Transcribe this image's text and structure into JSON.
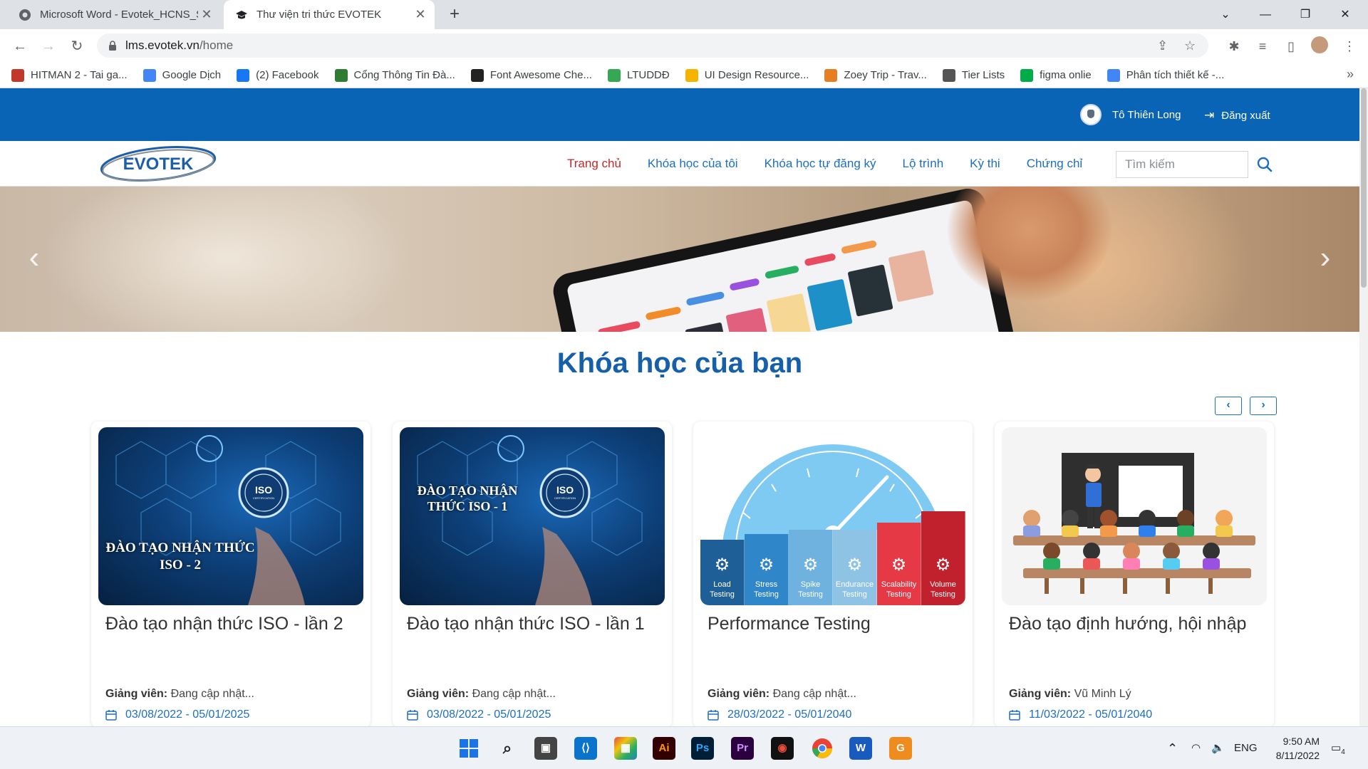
{
  "browser": {
    "tabs": [
      {
        "title": "Microsoft Word - Evotek_HCNS_S",
        "active": false
      },
      {
        "title": "Thư viện tri thức EVOTEK",
        "active": true
      }
    ],
    "url_host": "lms.evotek.vn",
    "url_path": "/home",
    "bookmarks": [
      {
        "label": "HITMAN 2 - Tai ga...",
        "color": "#c0392b"
      },
      {
        "label": "Google Dịch",
        "color": "#4285f4"
      },
      {
        "label": "(2) Facebook",
        "color": "#1877f2"
      },
      {
        "label": "Cổng Thông Tin Đà...",
        "color": "#2e7d32"
      },
      {
        "label": "Font Awesome Che...",
        "color": "#222222"
      },
      {
        "label": "LTUDDĐ",
        "color": "#34a853"
      },
      {
        "label": "UI Design Resource...",
        "color": "#f4b400"
      },
      {
        "label": "Zoey Trip - Trav...",
        "color": "#e67e22"
      },
      {
        "label": "Tier Lists",
        "color": "#555555"
      },
      {
        "label": "figma onlie",
        "color": "#00ac47"
      },
      {
        "label": "Phân tích thiết kế -...",
        "color": "#4285f4"
      }
    ]
  },
  "site": {
    "user_name": "Tô Thiên Long",
    "logout_label": "Đăng xuất",
    "logo_text": "EVOTEK",
    "nav": [
      {
        "label": "Trang chủ",
        "active": true
      },
      {
        "label": "Khóa học của tôi",
        "active": false
      },
      {
        "label": "Khóa học tự đăng ký",
        "active": false
      },
      {
        "label": "Lộ trình",
        "active": false
      },
      {
        "label": "Kỳ thi",
        "active": false
      },
      {
        "label": "Chứng chỉ",
        "active": false
      }
    ],
    "search_placeholder": "Tìm kiếm",
    "section_title": "Khóa học của bạn",
    "teacher_label": "Giảng viên:",
    "courses": [
      {
        "title": "Đào tạo nhận thức ISO - lần 2",
        "teacher": "Đang cập nhật...",
        "dates": "03/08/2022 - 05/01/2025",
        "thumb_text": "ĐÀO TẠO NHẬN THỨC ISO - 2"
      },
      {
        "title": "Đào tạo nhận thức ISO - lần 1",
        "teacher": "Đang cập nhật...",
        "dates": "03/08/2022 - 05/01/2025",
        "thumb_text": "ĐÀO TẠO NHẬN THỨC ISO - 1"
      },
      {
        "title": "Performance Testing",
        "teacher": "Đang cập nhật...",
        "dates": "28/03/2022 - 05/01/2040",
        "thumb_text": ""
      },
      {
        "title": "Đào tạo định hướng, hội nhập",
        "teacher": "Vũ Minh Lý",
        "dates": "11/03/2022 - 05/01/2040",
        "thumb_text": ""
      }
    ],
    "perf_segments": [
      {
        "line1": "Load",
        "line2": "Testing",
        "color": "#1f5f97"
      },
      {
        "line1": "Stress",
        "line2": "Testing",
        "color": "#2f86c8"
      },
      {
        "line1": "Spike",
        "line2": "Testing",
        "color": "#6fb2e0"
      },
      {
        "line1": "Endurance",
        "line2": "Testing",
        "color": "#8fc3e6"
      },
      {
        "line1": "Scalability",
        "line2": "Testing",
        "color": "#e53945"
      },
      {
        "line1": "Volume",
        "line2": "Testing",
        "color": "#c1202d"
      }
    ],
    "iso_badge": "ISO",
    "iso_badge_sub": "CERTIFICATION"
  },
  "taskbar": {
    "lang": "ENG",
    "time": "9:50 AM",
    "date": "8/11/2022",
    "notif_count": "4"
  }
}
